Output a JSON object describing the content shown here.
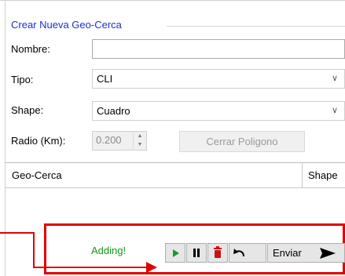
{
  "form": {
    "group_title": "Crear Nueva Geo-Cerca",
    "nombre_label": "Nombre:",
    "nombre_value": "",
    "tipo_label": "Tipo:",
    "tipo_value": "CLI",
    "shape_label": "Shape:",
    "shape_value": "Cuadro",
    "radio_label": "Radio (Km):",
    "radio_value": "0.200",
    "cerrar_label": "Cerrar Poligono"
  },
  "table": {
    "columns": [
      "Geo-Cerca",
      "Shape"
    ]
  },
  "toolbar": {
    "status": "Adding!",
    "play_icon": "play-icon",
    "pause_icon": "pause-icon",
    "delete_icon": "trash-icon",
    "undo_icon": "undo-icon",
    "send_label": "Enviar",
    "send_icon": "send-icon"
  },
  "annotation": {
    "highlight_color": "#e00000",
    "status_color": "#119a1a",
    "title_color": "#1e2fcf"
  }
}
